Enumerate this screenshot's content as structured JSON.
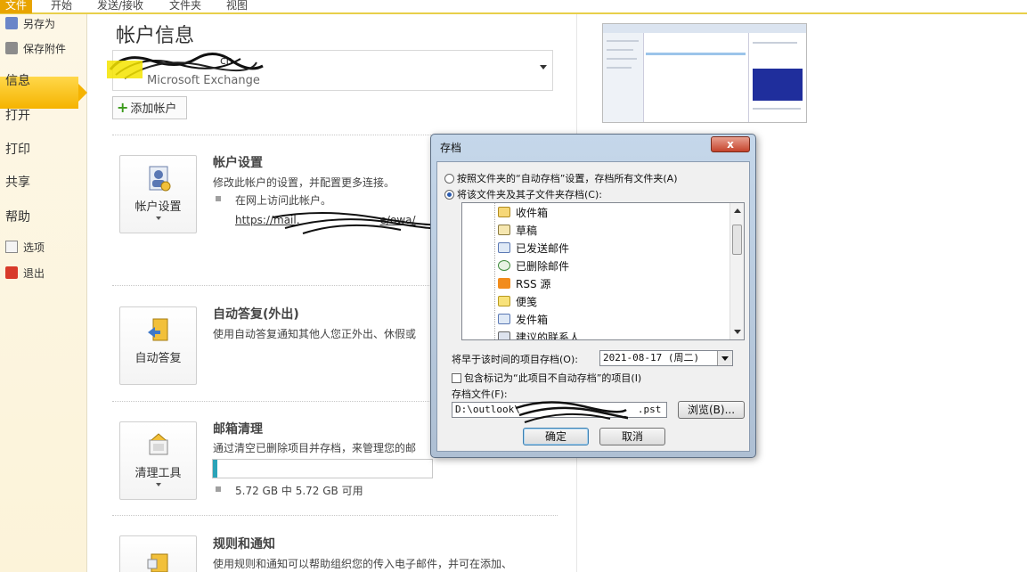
{
  "ribbon": {
    "tabs": [
      {
        "label": "文件"
      },
      {
        "label": "开始"
      },
      {
        "label": "发送/接收"
      },
      {
        "label": "文件夹"
      },
      {
        "label": "视图"
      }
    ]
  },
  "nav": {
    "save_as": "另存为",
    "save_attachments": "保存附件",
    "info": "信息",
    "open": "打开",
    "print": "打印",
    "share": "共享",
    "help": "帮助",
    "options": "选项",
    "exit": "退出"
  },
  "main": {
    "title": "帐户信息",
    "account_email": "cn",
    "account_type": "Microsoft Exchange",
    "add_account": "添加帐户",
    "account_settings": {
      "button": "帐户设置",
      "heading": "帐户设置",
      "description": "修改此帐户的设置，并配置更多连接。",
      "bullet": "在网上访问此帐户。",
      "link": "https://mail.",
      "link_tail": "e/owa/"
    },
    "auto_reply": {
      "button": "自动答复",
      "heading": "自动答复(外出)",
      "description": "使用自动答复通知其他人您正外出、休假或"
    },
    "cleanup": {
      "button": "清理工具",
      "heading": "邮箱清理",
      "description": "通过清空已删除项目并存档，来管理您的邮",
      "storage": "5.72 GB 中 5.72 GB 可用",
      "progress_fraction": 0.02
    },
    "rules": {
      "heading": "规则和通知",
      "description": "使用规则和通知可以帮助组织您的传入电子邮件，并可在添加、"
    }
  },
  "dialog": {
    "title": "存档",
    "close_label": "x",
    "radio_auto": "按照文件夹的“自动存档”设置，存档所有文件夹(A)",
    "radio_folder": "将该文件夹及其子文件夹存档(C):",
    "folders": [
      {
        "label": "收件箱",
        "icon": "inbox-icon"
      },
      {
        "label": "草稿",
        "icon": "drafts-icon"
      },
      {
        "label": "已发送邮件",
        "icon": "sent-icon"
      },
      {
        "label": "已删除邮件",
        "icon": "deleted-icon"
      },
      {
        "label": "RSS 源",
        "icon": "rss-icon"
      },
      {
        "label": "便笺",
        "icon": "notes-icon"
      },
      {
        "label": "发件箱",
        "icon": "outbox-icon"
      },
      {
        "label": "建议的联系人",
        "icon": "contacts-icon"
      }
    ],
    "date_label": "将早于该时间的项目存档(O):",
    "date_value": "2021-08-17 (周二)",
    "checkbox_label": "包含标记为“此项目不自动存档”的项目(I)",
    "file_label": "存档文件(F):",
    "file_path": "D:\\outlook\\",
    "file_path_tail": ".pst",
    "browse": "浏览(B)...",
    "ok": "确定",
    "cancel": "取消"
  },
  "colors": {
    "accent": "#f5b300",
    "file_tab": "#e8a400",
    "progress": "#2aa3b8",
    "dialog_frame": "#c5d7ea"
  }
}
